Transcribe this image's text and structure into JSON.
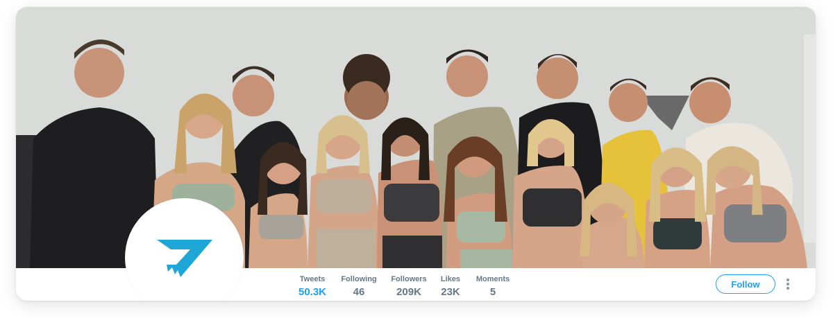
{
  "profile": {
    "brand_color": "#1da1f2",
    "logo_color": "#1ea7d6"
  },
  "stats": [
    {
      "label": "Tweets",
      "value": "50.3K",
      "active": true
    },
    {
      "label": "Following",
      "value": "46"
    },
    {
      "label": "Followers",
      "value": "209K"
    },
    {
      "label": "Likes",
      "value": "23K"
    },
    {
      "label": "Moments",
      "value": "5"
    }
  ],
  "actions": {
    "follow_label": "Follow",
    "more_icon": "more-vertical-icon"
  },
  "banner": {
    "icon": "group-photo-image"
  }
}
